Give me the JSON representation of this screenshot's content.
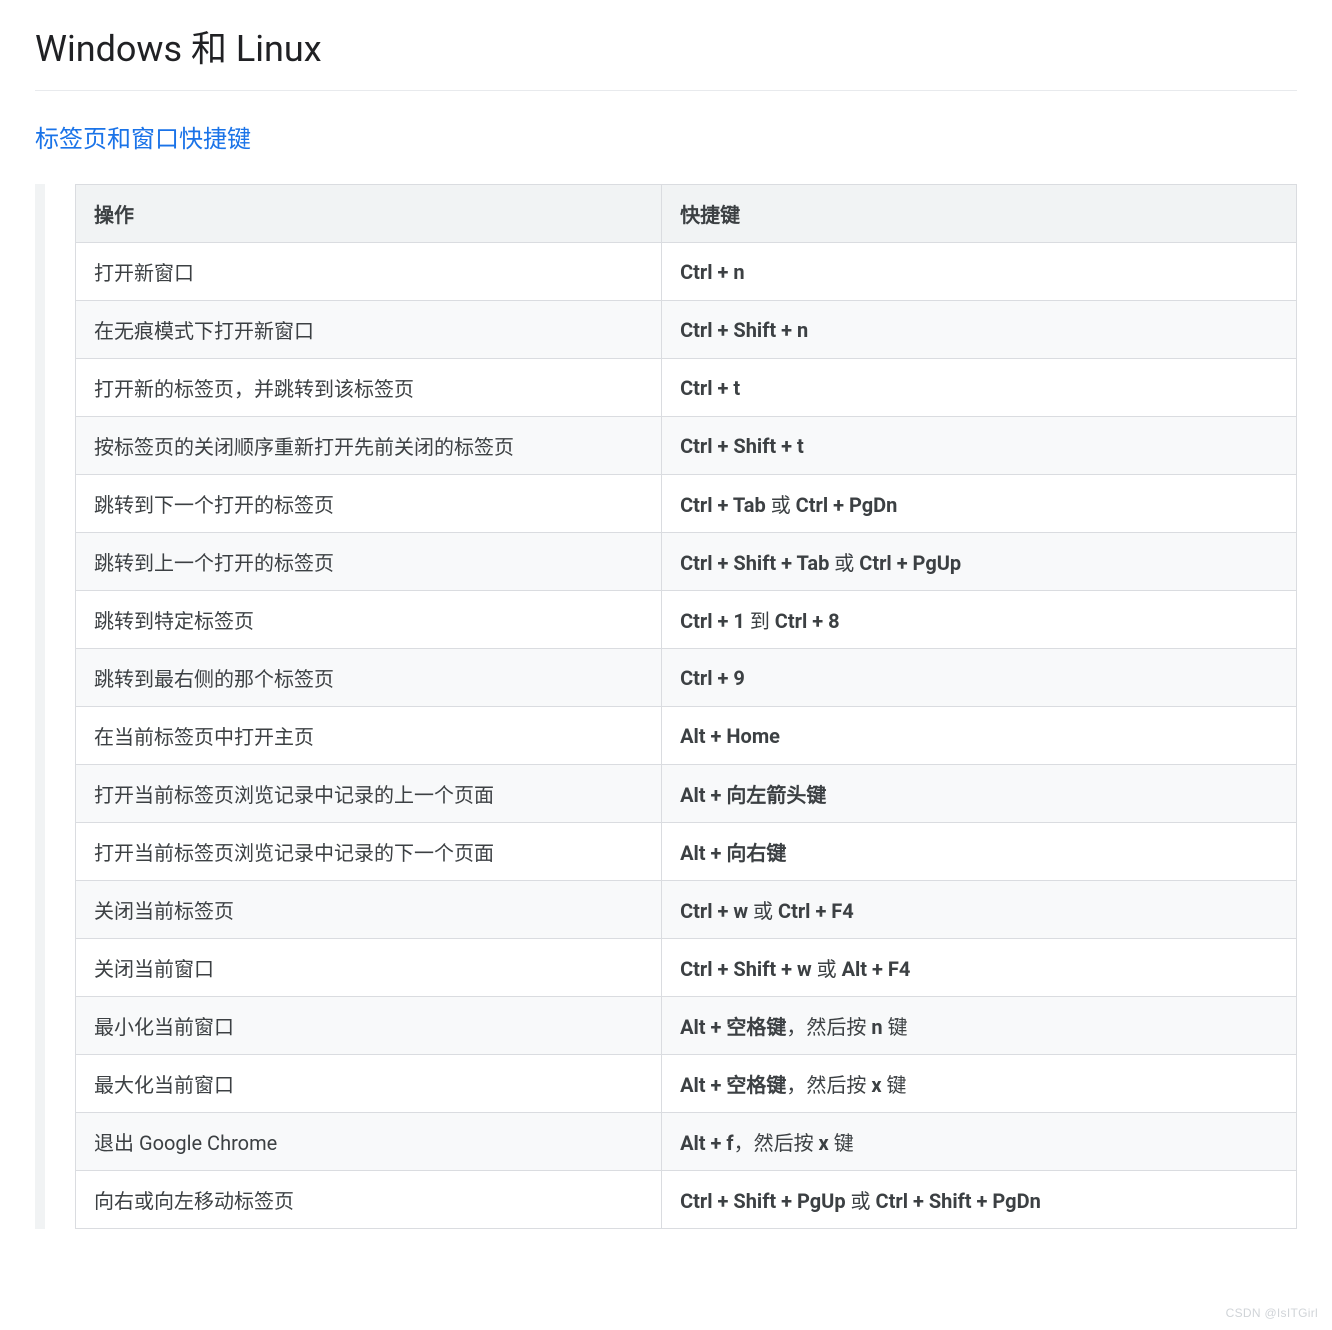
{
  "heading": "Windows 和 Linux",
  "section_link": "标签页和窗口快捷键",
  "columns": {
    "action": "操作",
    "shortcut": "快捷键"
  },
  "rows": [
    {
      "action": "打开新窗口",
      "shortcut": [
        {
          "t": "b",
          "v": "Ctrl + n"
        }
      ]
    },
    {
      "action": "在无痕模式下打开新窗口",
      "shortcut": [
        {
          "t": "b",
          "v": "Ctrl + Shift + n"
        }
      ]
    },
    {
      "action": "打开新的标签页，并跳转到该标签页",
      "shortcut": [
        {
          "t": "b",
          "v": "Ctrl + t"
        }
      ]
    },
    {
      "action": "按标签页的关闭顺序重新打开先前关闭的标签页",
      "shortcut": [
        {
          "t": "b",
          "v": "Ctrl + Shift + t"
        }
      ]
    },
    {
      "action": "跳转到下一个打开的标签页",
      "shortcut": [
        {
          "t": "b",
          "v": "Ctrl + Tab"
        },
        {
          "t": "p",
          "v": " 或 "
        },
        {
          "t": "b",
          "v": "Ctrl + PgDn"
        }
      ]
    },
    {
      "action": "跳转到上一个打开的标签页",
      "shortcut": [
        {
          "t": "b",
          "v": "Ctrl + Shift + Tab"
        },
        {
          "t": "p",
          "v": " 或 "
        },
        {
          "t": "b",
          "v": "Ctrl + PgUp"
        }
      ]
    },
    {
      "action": "跳转到特定标签页",
      "shortcut": [
        {
          "t": "b",
          "v": "Ctrl + 1"
        },
        {
          "t": "p",
          "v": " 到 "
        },
        {
          "t": "b",
          "v": "Ctrl + 8"
        }
      ]
    },
    {
      "action": "跳转到最右侧的那个标签页",
      "shortcut": [
        {
          "t": "b",
          "v": "Ctrl + 9"
        }
      ]
    },
    {
      "action": "在当前标签页中打开主页",
      "shortcut": [
        {
          "t": "b",
          "v": "Alt + Home"
        }
      ]
    },
    {
      "action": "打开当前标签页浏览记录中记录的上一个页面",
      "shortcut": [
        {
          "t": "b",
          "v": "Alt + 向左箭头键"
        }
      ]
    },
    {
      "action": "打开当前标签页浏览记录中记录的下一个页面",
      "shortcut": [
        {
          "t": "b",
          "v": "Alt + 向右键"
        }
      ]
    },
    {
      "action": "关闭当前标签页",
      "shortcut": [
        {
          "t": "b",
          "v": "Ctrl + w"
        },
        {
          "t": "p",
          "v": " 或 "
        },
        {
          "t": "b",
          "v": "Ctrl + F4"
        }
      ]
    },
    {
      "action": "关闭当前窗口",
      "shortcut": [
        {
          "t": "b",
          "v": "Ctrl + Shift + w"
        },
        {
          "t": "p",
          "v": " 或 "
        },
        {
          "t": "b",
          "v": "Alt + F4"
        }
      ]
    },
    {
      "action": "最小化当前窗口",
      "shortcut": [
        {
          "t": "b",
          "v": "Alt + 空格键"
        },
        {
          "t": "p",
          "v": "，然后按 "
        },
        {
          "t": "b",
          "v": "n"
        },
        {
          "t": "p",
          "v": " 键"
        }
      ]
    },
    {
      "action": "最大化当前窗口",
      "shortcut": [
        {
          "t": "b",
          "v": "Alt + 空格键"
        },
        {
          "t": "p",
          "v": "，然后按 "
        },
        {
          "t": "b",
          "v": "x"
        },
        {
          "t": "p",
          "v": " 键"
        }
      ]
    },
    {
      "action": "退出 Google Chrome",
      "shortcut": [
        {
          "t": "b",
          "v": "Alt + f"
        },
        {
          "t": "p",
          "v": "，然后按 "
        },
        {
          "t": "b",
          "v": "x"
        },
        {
          "t": "p",
          "v": " 键"
        }
      ]
    },
    {
      "action": "向右或向左移动标签页",
      "shortcut": [
        {
          "t": "b",
          "v": "Ctrl + Shift + PgUp"
        },
        {
          "t": "p",
          "v": " 或 "
        },
        {
          "t": "b",
          "v": "Ctrl + Shift + PgDn"
        }
      ]
    }
  ],
  "watermark": "CSDN @IsITGirl"
}
